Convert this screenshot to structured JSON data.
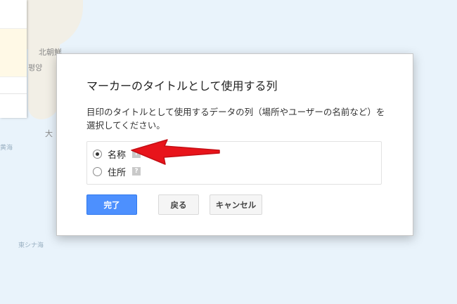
{
  "map": {
    "labels": {
      "north_korea": "北朝鮮",
      "pyongyang": "평양",
      "daikan": "大",
      "sea_west": "黄海",
      "east_china_sea": "東シナ海"
    }
  },
  "dialog": {
    "title": "マーカーのタイトルとして使用する列",
    "description": "目印のタイトルとして使用するデータの列（場所やユーザーの名前など）を選択してください。",
    "options": [
      {
        "label": "名称",
        "selected": true,
        "help": "?"
      },
      {
        "label": "住所",
        "selected": false,
        "help": "?"
      }
    ],
    "buttons": {
      "done": "完了",
      "back": "戻る",
      "cancel": "キャンセル"
    }
  },
  "colors": {
    "primary_button": "#4d90fe",
    "annotation_arrow": "#e8141b"
  }
}
